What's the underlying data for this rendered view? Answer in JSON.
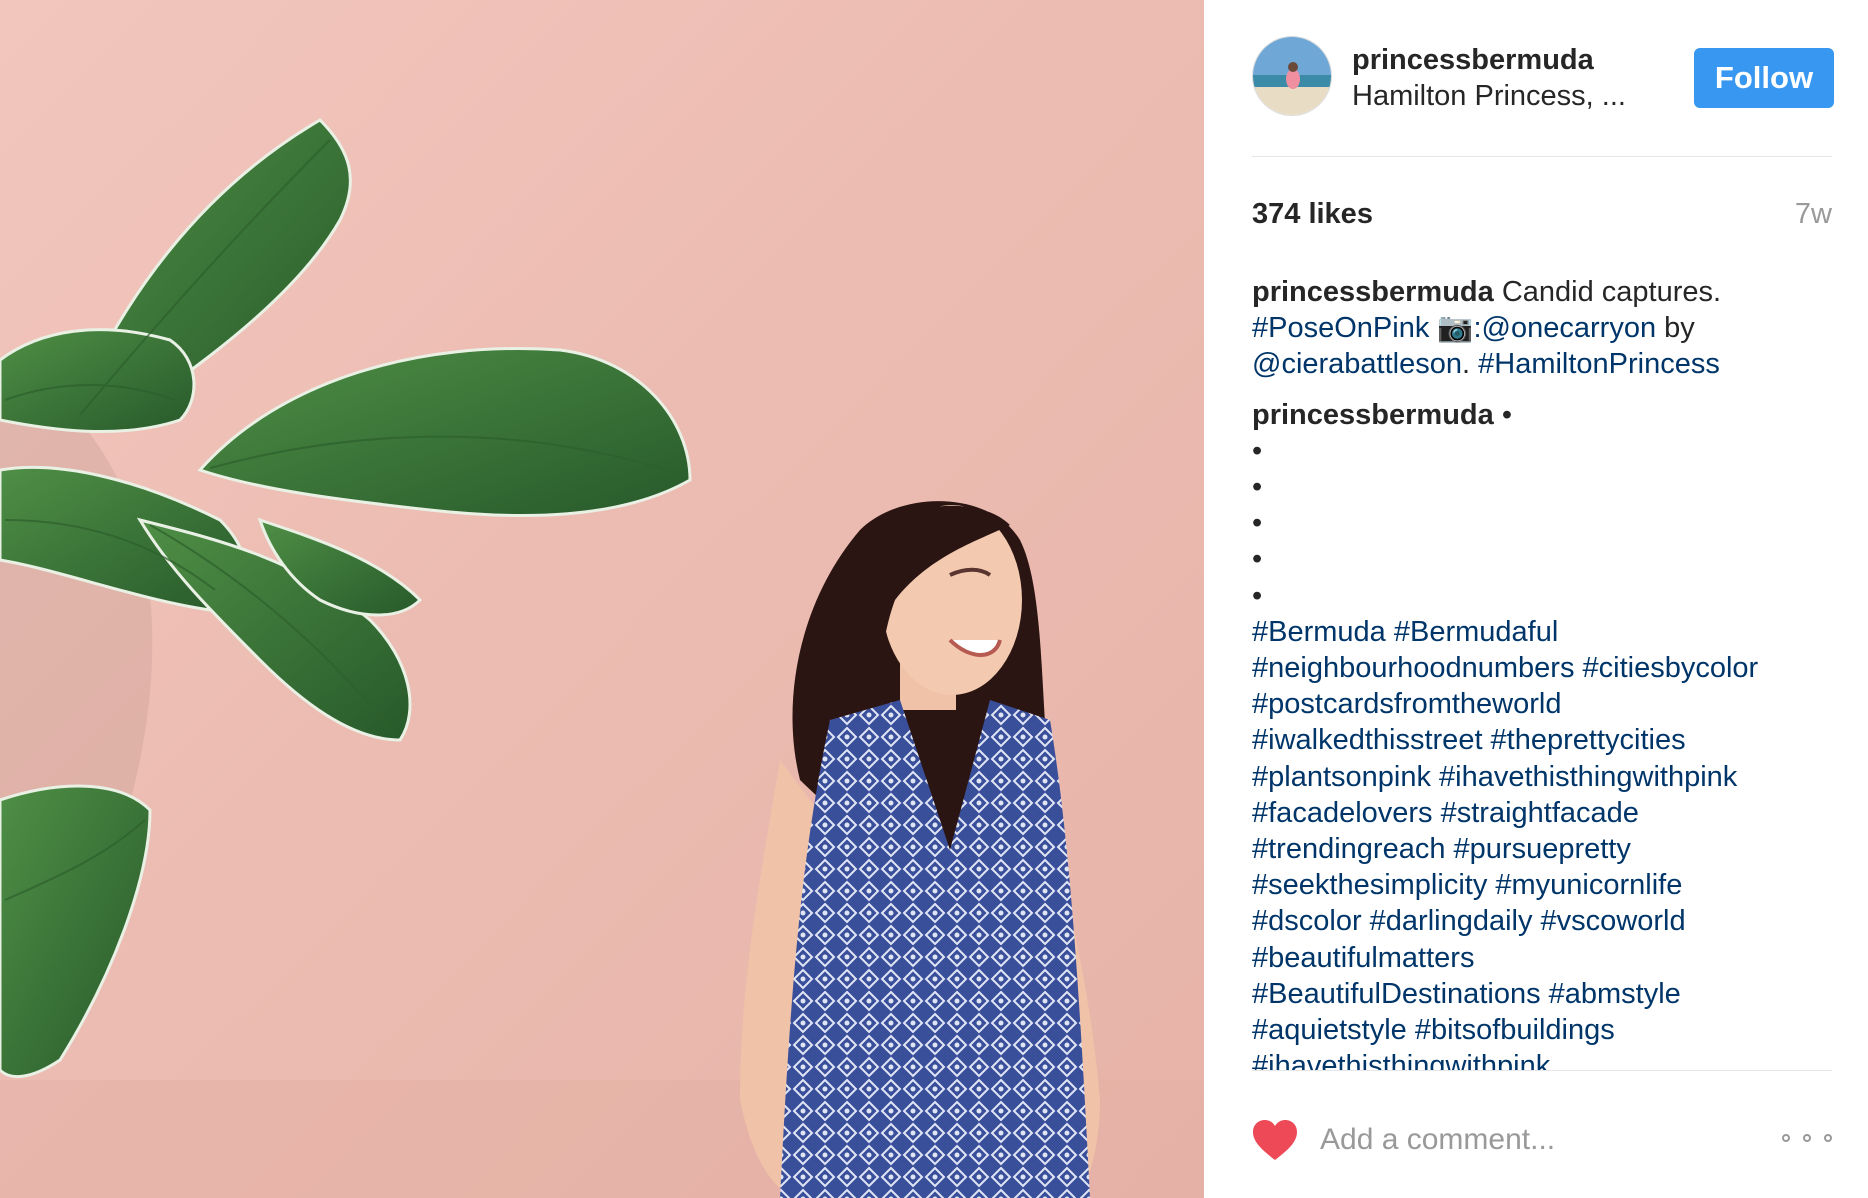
{
  "post": {
    "username": "princessbermuda",
    "location": "Hamilton Princess, ...",
    "follow_label": "Follow",
    "likes": "374 likes",
    "age": "7w",
    "caption": {
      "author": "princessbermuda",
      "text1": " Candid captures.",
      "tag1": "#PoseOnPink",
      "camera": "📷",
      "mention1": ":@onecarryon",
      "text2": " by",
      "mention2": "@cierabattleson",
      "text3": ". ",
      "tag2": "#HamiltonPrincess"
    },
    "comment2": {
      "author": "princessbermuda",
      "bullet_inline": " •",
      "bullets": [
        "•",
        "•",
        "•",
        "•",
        "•"
      ],
      "hashtag_lines": [
        "#Bermuda #Bermudaful",
        "#neighbourhoodnumbers #citiesbycolor",
        "#postcardsfromtheworld",
        "#iwalkedthisstreet #theprettycities",
        "#plantsonpink #ihavethisthingwithpink",
        "#facadelovers #straightfacade",
        "#trendingreach #pursuepretty",
        "#seekthesimplicity #myunicornlife",
        "#dscolor #darlingdaily #vscoworld",
        "#beautifulmatters",
        "#BeautifulDestinations #abmstyle",
        "#aquietstyle #bitsofbuildings",
        "#ihavethisthingwithpink"
      ]
    },
    "comment_placeholder": "Add a comment...",
    "colors": {
      "follow_bg": "#3897f0",
      "link": "#003569",
      "heart": "#ed4956",
      "muted": "#999999",
      "wall_pink": "#ecbcb2"
    },
    "icons": {
      "like": "heart-icon",
      "more": "more-options-icon"
    }
  }
}
